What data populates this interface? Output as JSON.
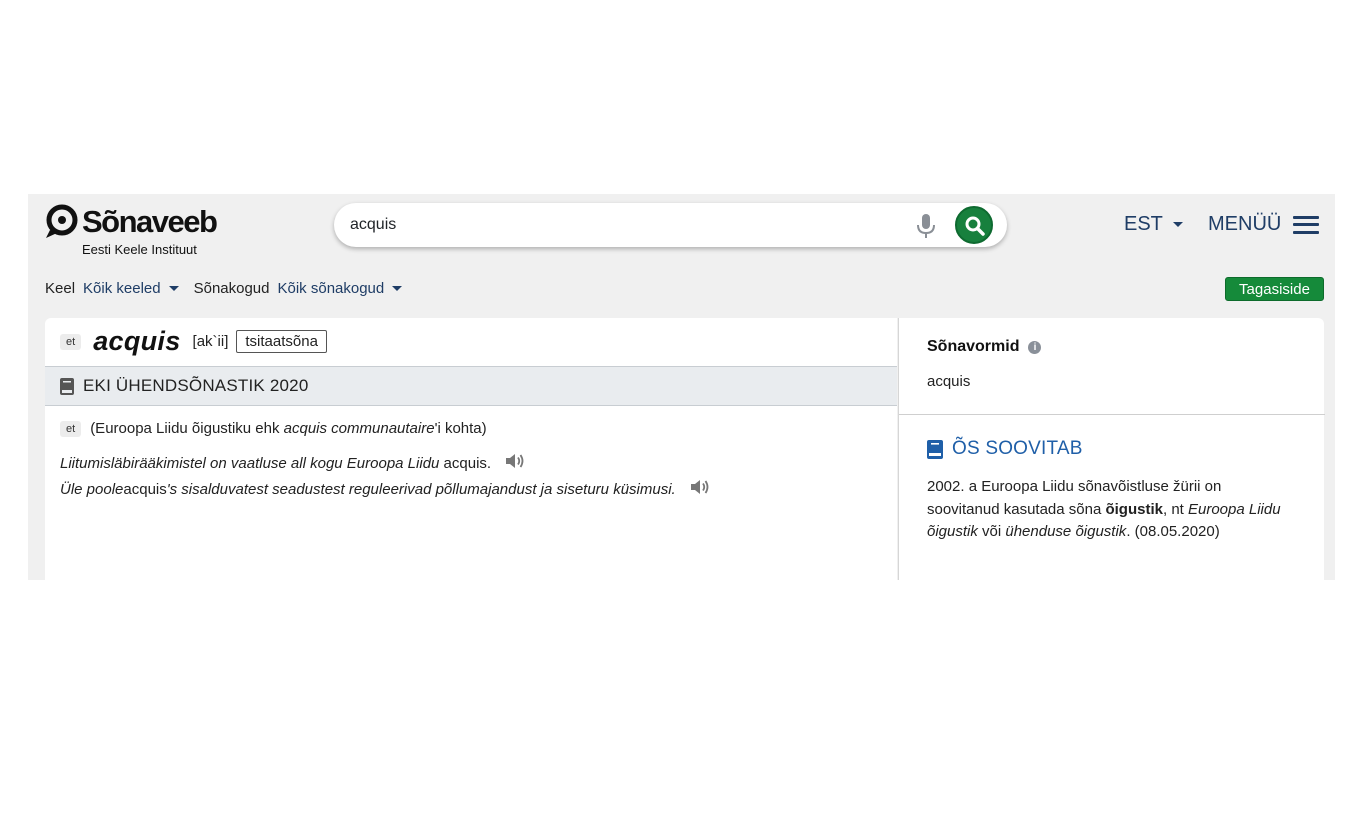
{
  "header": {
    "logo_text": "Sõnaveeb",
    "logo_subtitle": "Eesti Keele Instituut",
    "search_value": "acquis",
    "language": "EST",
    "menu_label": "MENÜÜ"
  },
  "filters": {
    "language_label": "Keel",
    "language_value": "Kõik keeled",
    "collections_label": "Sõnakogud",
    "collections_value": "Kõik sõnakogud",
    "feedback_label": "Tagasiside"
  },
  "entry": {
    "lang_tag": "et",
    "headword": "acquis",
    "pronunciation": "[ak`ii]",
    "word_type": "tsitaatsõna",
    "source_title": "EKI ÜHENDSÕNASTIK 2020",
    "definition_lang_tag": "et",
    "definition_pre": "(Euroopa Liidu õigustiku ehk ",
    "definition_italic": "acquis communautaire",
    "definition_post": "'i kohta)",
    "example1_italic": "Liitumisläbirääkimistel on vaatluse all kogu Euroopa Liidu ",
    "example1_word": "acquis.",
    "example2_pre": "Üle poole ",
    "example2_word": "acquis",
    "example2_italic": "'s sisalduvatest seadustest reguleerivad põllumajandust ja siseturu küsimusi."
  },
  "sidebar": {
    "wordforms_title": "Sõnavormid",
    "wordforms_value": "acquis",
    "os_title": "ÕS SOOVITAB",
    "os_text_1": "2002. a Euroopa Liidu sõnavõistluse žürii on soovitanud kasutada sõna ",
    "os_text_bold": "õigustik",
    "os_text_2": ", nt ",
    "os_text_italic1": "Euroopa Liidu õigustik",
    "os_text_3": " või ",
    "os_text_italic2": "ühenduse õigustik",
    "os_text_4": ". (08.05.2020)"
  },
  "colors": {
    "search_button": "#17803d",
    "feedback_button": "#158a3a",
    "link": "#1f3d66",
    "os_title": "#1f5fa8"
  },
  "icons": [
    "speech-bubble-logo-icon",
    "microphone-icon",
    "search-icon",
    "caret-down-icon",
    "hamburger-icon",
    "book-icon",
    "speaker-icon",
    "info-icon"
  ]
}
